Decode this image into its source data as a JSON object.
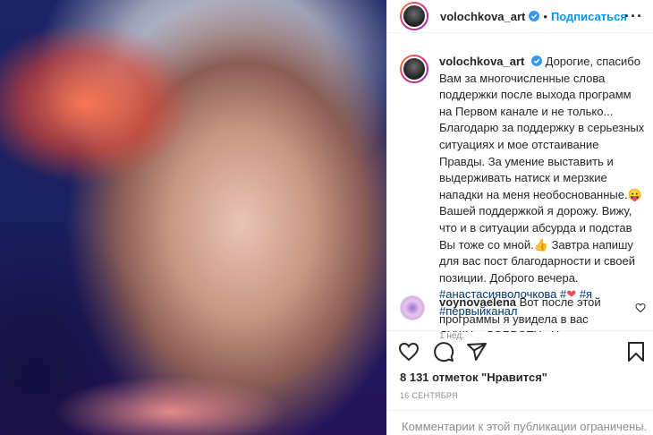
{
  "header": {
    "username": "volochkova_art",
    "separator": "•",
    "follow_label": "Подписаться",
    "more_label": "···"
  },
  "caption": {
    "username": "volochkova_art",
    "text_part1": "Дорогие, спасибо Вам за многочисленные слова поддержки после выхода программ на Первом канале и не только... Благодарю за поддержку в серьезных ситуациях и мое отстаивание Правды. За умение выставить и выдерживать натиск и мерзкие нападки на меня необоснованные.",
    "emoji1": "😛",
    "text_part2": " Вашей поддержкой я дорожу. Вижу, что и в ситуации абсурда и подстав Вы тоже со мной.",
    "emoji2": "👍",
    "text_part3": " Завтра напишу для вас пост благодарности и своей позиции. Доброго вечера. ",
    "hashtag1": "#анастасияволочкова",
    "hashtag_prefix": "#",
    "heart_emoji": "❤",
    "hashtag2": "#я",
    "hashtag3": "#первыйканал",
    "time_ago": "1 нед."
  },
  "comment": {
    "username": "voynovaelena",
    "text": "Вот после этой программы я увидела в вас ДУШУ и ДОБРОТУ . Не прячьте чаще"
  },
  "likes": "8 131 отметок \"Нравится\"",
  "date": "16 СЕНТЯБРЯ",
  "footer": "Комментарии к этой публикации ограничены.",
  "colors": {
    "accent": "#0095f6",
    "hashtag": "#00376b",
    "heart": "#ed4956",
    "muted": "#8e8e8e"
  }
}
